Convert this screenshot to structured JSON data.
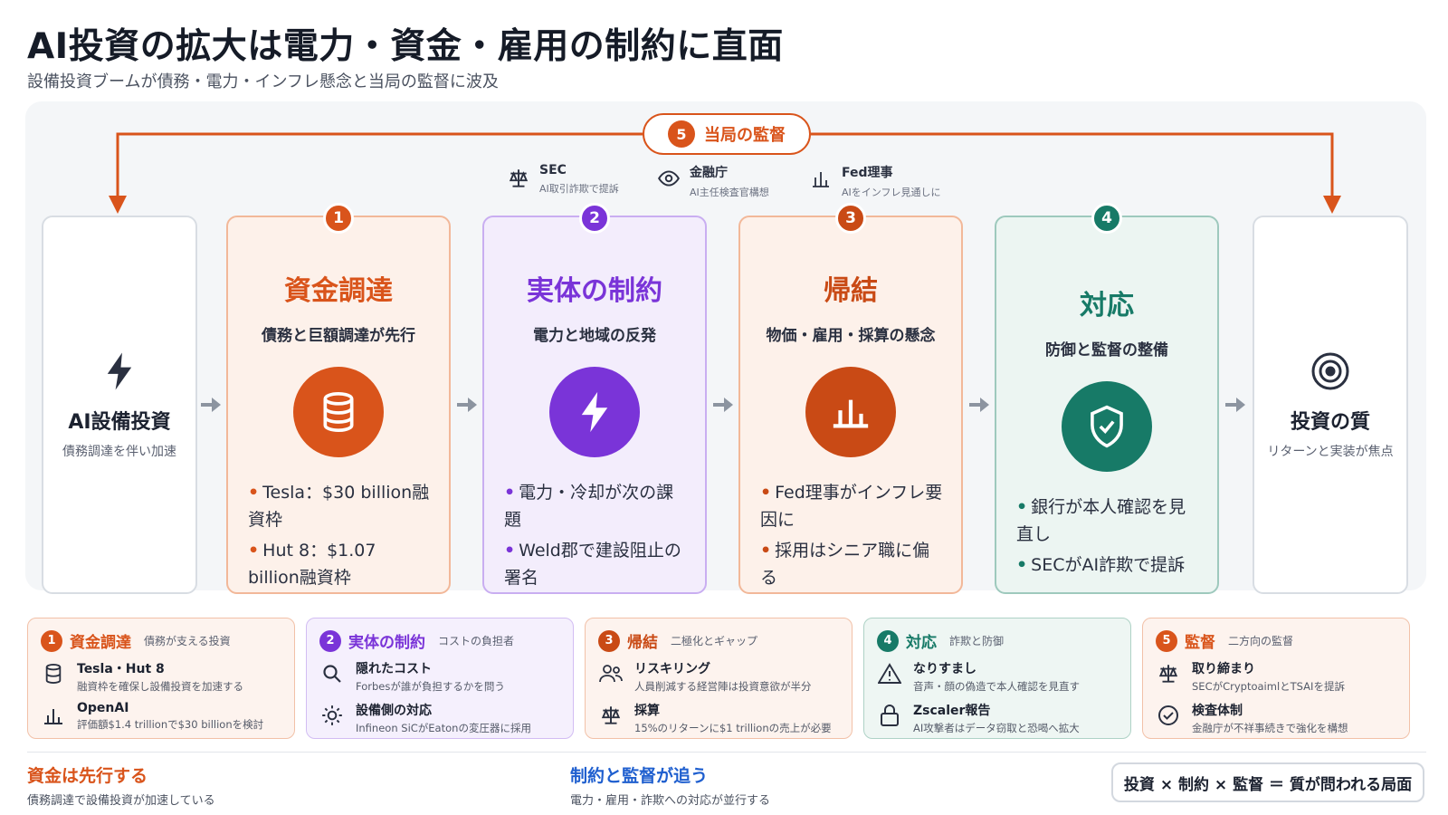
{
  "header": {
    "title": "AI投資の拡大は電力・資金・雇用の制約に直面",
    "subtitle": "設備投資ブームが債務・電力・インフレ懸念と当局の監督に波及"
  },
  "oversight": {
    "number": "5",
    "label": "当局の監督"
  },
  "regulators": [
    {
      "name": "SEC",
      "note": "AI取引詐欺で提訴",
      "icon": "scales-icon"
    },
    {
      "name": "金融庁",
      "note": "AI主任検査官構想",
      "icon": "eye-icon"
    },
    {
      "name": "Fed理事",
      "note": "AIをインフレ見通しに",
      "icon": "bar-chart-icon"
    }
  ],
  "start": {
    "title": "AI設備投資",
    "caption": "債務調達を伴い加速",
    "icon": "lightning-icon"
  },
  "end": {
    "title": "投資の質",
    "caption": "リターンと実装が焦点",
    "icon": "target-icon"
  },
  "stages": [
    {
      "number": "1",
      "title": "資金調達",
      "subtitle": "債務と巨額調達が先行",
      "color": "#d9541b",
      "icon": "database-icon",
      "bullets": [
        "Tesla：$30 billion融資枠",
        "Hut 8：$1.07 billion融資枠"
      ]
    },
    {
      "number": "2",
      "title": "実体の制約",
      "subtitle": "電力と地域の反発",
      "color": "#7a34d8",
      "icon": "lightning-icon",
      "bullets": [
        "電力・冷却が次の課題",
        "Weld郡で建設阻止の署名"
      ]
    },
    {
      "number": "3",
      "title": "帰結",
      "subtitle": "物価・雇用・採算の懸念",
      "color": "#c94a15",
      "icon": "bar-chart-icon",
      "bullets": [
        "Fed理事がインフレ要因に",
        "採用はシニア職に偏る"
      ]
    },
    {
      "number": "4",
      "title": "対応",
      "subtitle": "防御と監督の整備",
      "color": "#177a67",
      "icon": "shield-check-icon",
      "bullets": [
        "銀行が本人確認を見直し",
        "SECがAI詐欺で提訴"
      ]
    }
  ],
  "cards": [
    {
      "number": "1",
      "title": "資金調達",
      "tag": "債務が支える投資",
      "color": "#d9541b",
      "rows": [
        {
          "icon": "database-icon",
          "title": "Tesla・Hut 8",
          "desc": "融資枠を確保し設備投資を加速する"
        },
        {
          "icon": "bar-chart-icon",
          "title": "OpenAI",
          "desc": "評価額$1.4 trillionで$30 billionを検討"
        }
      ]
    },
    {
      "number": "2",
      "title": "実体の制約",
      "tag": "コストの負担者",
      "color": "#7a34d8",
      "rows": [
        {
          "icon": "search-icon",
          "title": "隠れたコスト",
          "desc": "Forbesが誰が負担するかを問う"
        },
        {
          "icon": "sun-icon",
          "title": "設備側の対応",
          "desc": "Infineon SiCがEatonの変圧器に採用"
        }
      ]
    },
    {
      "number": "3",
      "title": "帰結",
      "tag": "二極化とギャップ",
      "color": "#c94a15",
      "rows": [
        {
          "icon": "people-icon",
          "title": "リスキリング",
          "desc": "人員削減する経営陣は投資意欲が半分"
        },
        {
          "icon": "scales-icon",
          "title": "採算",
          "desc": "15%のリターンに$1 trillionの売上が必要"
        }
      ]
    },
    {
      "number": "4",
      "title": "対応",
      "tag": "詐欺と防御",
      "color": "#177a67",
      "rows": [
        {
          "icon": "warning-icon",
          "title": "なりすまし",
          "desc": "音声・顔の偽造で本人確認を見直す"
        },
        {
          "icon": "lock-icon",
          "title": "Zscaler報告",
          "desc": "AI攻撃者はデータ窃取と恐喝へ拡大"
        }
      ]
    },
    {
      "number": "5",
      "title": "監督",
      "tag": "二方向の監督",
      "color": "#d9541b",
      "rows": [
        {
          "icon": "scales-icon",
          "title": "取り締まり",
          "desc": "SECがCryptoaimlとTSAIを提訴"
        },
        {
          "icon": "check-circle-icon",
          "title": "検査体制",
          "desc": "金融庁が不祥事続きで強化を構想"
        }
      ]
    }
  ],
  "footer": {
    "left_title": "資金は先行する",
    "left_caption": "債務調達で設備投資が加速している",
    "left_color": "#d9541b",
    "mid_title": "制約と監督が追う",
    "mid_caption": "電力・雇用・詐欺への対応が並行する",
    "mid_color": "#1f5fcf",
    "equation": "投資 × 制約 × 監督 ＝ 質が問われる局面"
  }
}
